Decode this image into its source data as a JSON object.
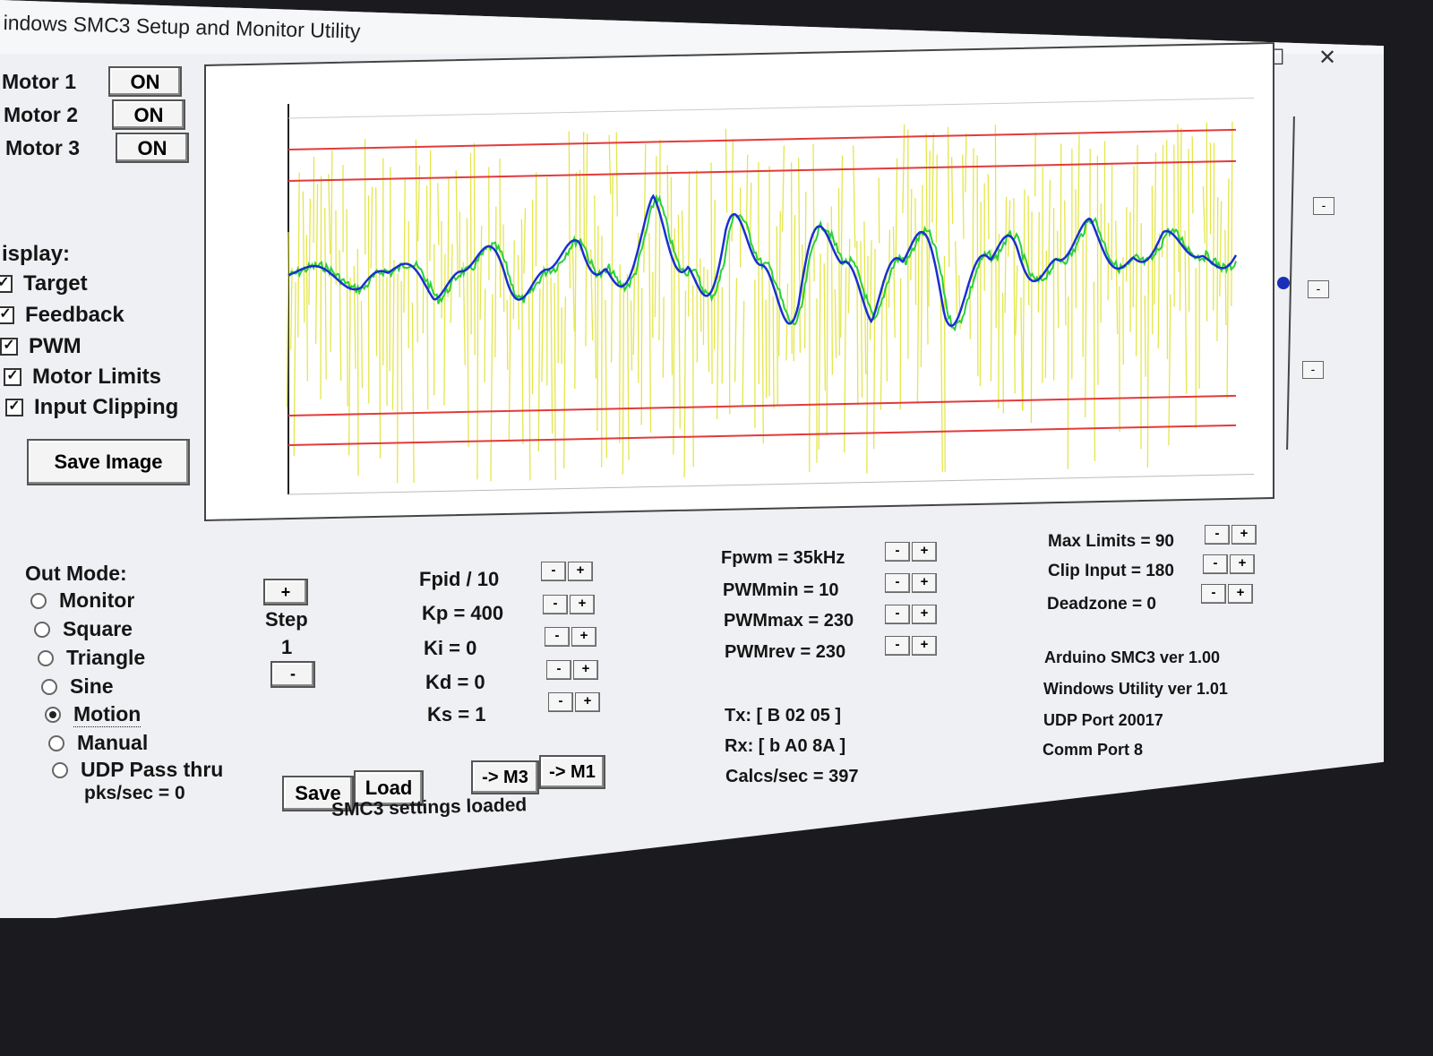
{
  "window": {
    "title": "indows SMC3 Setup and Monitor Utility",
    "controls": {
      "minimize": "—",
      "maximize": "☐",
      "close": "✕"
    }
  },
  "motors": [
    {
      "label": "Motor 1",
      "state": "ON"
    },
    {
      "label": "Motor 2",
      "state": "ON"
    },
    {
      "label": "Motor 3",
      "state": "ON"
    }
  ],
  "display": {
    "heading": "isplay:",
    "options": [
      {
        "label": "Target",
        "checked": true
      },
      {
        "label": "Feedback",
        "checked": true
      },
      {
        "label": "PWM",
        "checked": true
      },
      {
        "label": "Motor Limits",
        "checked": true
      },
      {
        "label": "Input Clipping",
        "checked": true
      }
    ],
    "save_image_label": "Save Image"
  },
  "out_mode": {
    "heading": "Out Mode:",
    "options": [
      {
        "label": "Monitor",
        "selected": false
      },
      {
        "label": "Square",
        "selected": false
      },
      {
        "label": "Triangle",
        "selected": false
      },
      {
        "label": "Sine",
        "selected": false
      },
      {
        "label": "Motion",
        "selected": true
      },
      {
        "label": "Manual",
        "selected": false
      },
      {
        "label": "UDP Pass thru",
        "selected": false
      }
    ],
    "pks_sec": "pks/sec = 0"
  },
  "step": {
    "plus": "+",
    "label": "Step",
    "value": "1",
    "minus": "-"
  },
  "pid_params": [
    "Fpid / 10",
    "Kp = 400",
    "Ki = 0",
    "Kd = 0",
    "Ks = 1"
  ],
  "pwm_params": [
    "Fpwm = 35kHz",
    "PWMmin = 10",
    "PWMmax = 230",
    "PWMrev = 230"
  ],
  "limit_params": [
    "Max Limits = 90",
    "Clip Input = 180",
    "Deadzone = 0"
  ],
  "pm_labels": {
    "minus": "-",
    "plus": "+"
  },
  "comm": {
    "tx": "Tx: [ B 02 05 ]",
    "rx": "Rx: [ b A0 8A ]",
    "calcs": "Calcs/sec = 397"
  },
  "versions": [
    "Arduino SMC3 ver 1.00",
    "Windows Utility ver 1.01",
    "UDP Port 20017",
    "Comm Port 8"
  ],
  "buttons": {
    "save": "Save",
    "load": "Load",
    "to_m3": "-> M3",
    "to_m1": "-> M1"
  },
  "status": "SMC3 settings loaded",
  "scroll_buttons": {
    "minus": "-"
  },
  "slider": {
    "level": 0.52
  },
  "colors": {
    "target": "#1a2fd0",
    "feedback": "#2ccf3c",
    "pwm": "#e4e64a",
    "limits": "#e23b3b",
    "slider_thumb": "#1a2fb8"
  }
}
